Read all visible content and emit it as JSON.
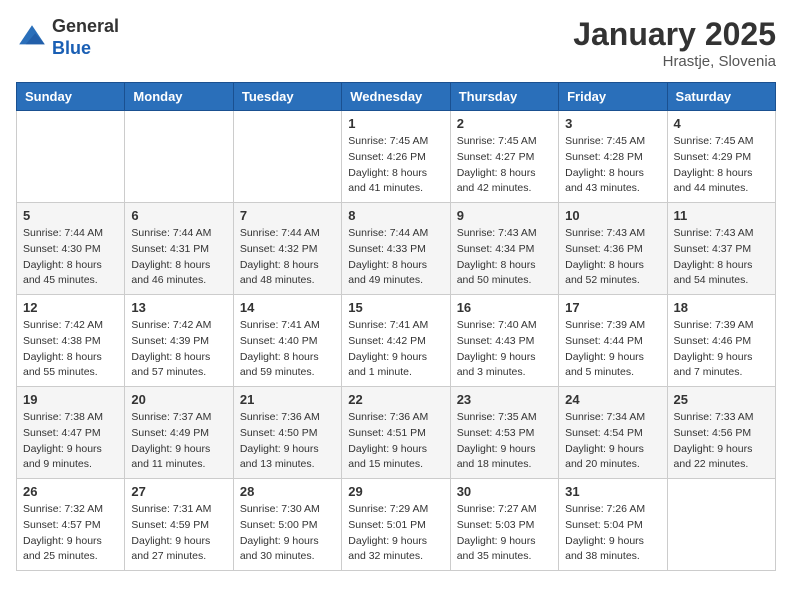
{
  "header": {
    "logo_line1": "General",
    "logo_line2": "Blue",
    "month_title": "January 2025",
    "location": "Hrastje, Slovenia"
  },
  "weekdays": [
    "Sunday",
    "Monday",
    "Tuesday",
    "Wednesday",
    "Thursday",
    "Friday",
    "Saturday"
  ],
  "weeks": [
    [
      {
        "day": "",
        "info": ""
      },
      {
        "day": "",
        "info": ""
      },
      {
        "day": "",
        "info": ""
      },
      {
        "day": "1",
        "info": "Sunrise: 7:45 AM\nSunset: 4:26 PM\nDaylight: 8 hours and 41 minutes."
      },
      {
        "day": "2",
        "info": "Sunrise: 7:45 AM\nSunset: 4:27 PM\nDaylight: 8 hours and 42 minutes."
      },
      {
        "day": "3",
        "info": "Sunrise: 7:45 AM\nSunset: 4:28 PM\nDaylight: 8 hours and 43 minutes."
      },
      {
        "day": "4",
        "info": "Sunrise: 7:45 AM\nSunset: 4:29 PM\nDaylight: 8 hours and 44 minutes."
      }
    ],
    [
      {
        "day": "5",
        "info": "Sunrise: 7:44 AM\nSunset: 4:30 PM\nDaylight: 8 hours and 45 minutes."
      },
      {
        "day": "6",
        "info": "Sunrise: 7:44 AM\nSunset: 4:31 PM\nDaylight: 8 hours and 46 minutes."
      },
      {
        "day": "7",
        "info": "Sunrise: 7:44 AM\nSunset: 4:32 PM\nDaylight: 8 hours and 48 minutes."
      },
      {
        "day": "8",
        "info": "Sunrise: 7:44 AM\nSunset: 4:33 PM\nDaylight: 8 hours and 49 minutes."
      },
      {
        "day": "9",
        "info": "Sunrise: 7:43 AM\nSunset: 4:34 PM\nDaylight: 8 hours and 50 minutes."
      },
      {
        "day": "10",
        "info": "Sunrise: 7:43 AM\nSunset: 4:36 PM\nDaylight: 8 hours and 52 minutes."
      },
      {
        "day": "11",
        "info": "Sunrise: 7:43 AM\nSunset: 4:37 PM\nDaylight: 8 hours and 54 minutes."
      }
    ],
    [
      {
        "day": "12",
        "info": "Sunrise: 7:42 AM\nSunset: 4:38 PM\nDaylight: 8 hours and 55 minutes."
      },
      {
        "day": "13",
        "info": "Sunrise: 7:42 AM\nSunset: 4:39 PM\nDaylight: 8 hours and 57 minutes."
      },
      {
        "day": "14",
        "info": "Sunrise: 7:41 AM\nSunset: 4:40 PM\nDaylight: 8 hours and 59 minutes."
      },
      {
        "day": "15",
        "info": "Sunrise: 7:41 AM\nSunset: 4:42 PM\nDaylight: 9 hours and 1 minute."
      },
      {
        "day": "16",
        "info": "Sunrise: 7:40 AM\nSunset: 4:43 PM\nDaylight: 9 hours and 3 minutes."
      },
      {
        "day": "17",
        "info": "Sunrise: 7:39 AM\nSunset: 4:44 PM\nDaylight: 9 hours and 5 minutes."
      },
      {
        "day": "18",
        "info": "Sunrise: 7:39 AM\nSunset: 4:46 PM\nDaylight: 9 hours and 7 minutes."
      }
    ],
    [
      {
        "day": "19",
        "info": "Sunrise: 7:38 AM\nSunset: 4:47 PM\nDaylight: 9 hours and 9 minutes."
      },
      {
        "day": "20",
        "info": "Sunrise: 7:37 AM\nSunset: 4:49 PM\nDaylight: 9 hours and 11 minutes."
      },
      {
        "day": "21",
        "info": "Sunrise: 7:36 AM\nSunset: 4:50 PM\nDaylight: 9 hours and 13 minutes."
      },
      {
        "day": "22",
        "info": "Sunrise: 7:36 AM\nSunset: 4:51 PM\nDaylight: 9 hours and 15 minutes."
      },
      {
        "day": "23",
        "info": "Sunrise: 7:35 AM\nSunset: 4:53 PM\nDaylight: 9 hours and 18 minutes."
      },
      {
        "day": "24",
        "info": "Sunrise: 7:34 AM\nSunset: 4:54 PM\nDaylight: 9 hours and 20 minutes."
      },
      {
        "day": "25",
        "info": "Sunrise: 7:33 AM\nSunset: 4:56 PM\nDaylight: 9 hours and 22 minutes."
      }
    ],
    [
      {
        "day": "26",
        "info": "Sunrise: 7:32 AM\nSunset: 4:57 PM\nDaylight: 9 hours and 25 minutes."
      },
      {
        "day": "27",
        "info": "Sunrise: 7:31 AM\nSunset: 4:59 PM\nDaylight: 9 hours and 27 minutes."
      },
      {
        "day": "28",
        "info": "Sunrise: 7:30 AM\nSunset: 5:00 PM\nDaylight: 9 hours and 30 minutes."
      },
      {
        "day": "29",
        "info": "Sunrise: 7:29 AM\nSunset: 5:01 PM\nDaylight: 9 hours and 32 minutes."
      },
      {
        "day": "30",
        "info": "Sunrise: 7:27 AM\nSunset: 5:03 PM\nDaylight: 9 hours and 35 minutes."
      },
      {
        "day": "31",
        "info": "Sunrise: 7:26 AM\nSunset: 5:04 PM\nDaylight: 9 hours and 38 minutes."
      },
      {
        "day": "",
        "info": ""
      }
    ]
  ]
}
